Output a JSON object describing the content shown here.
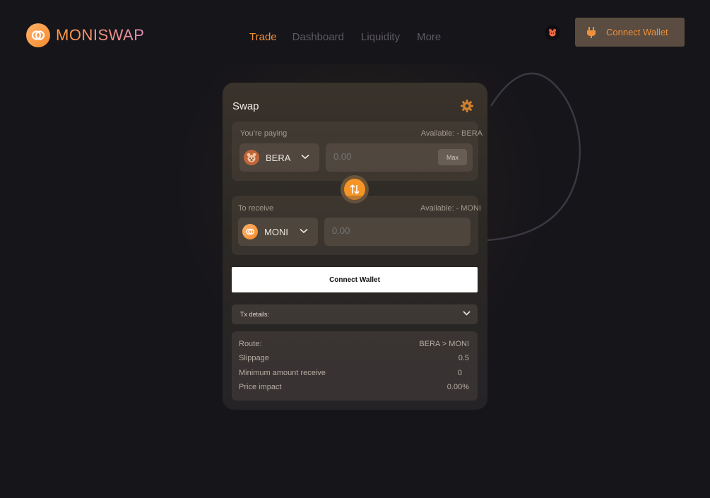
{
  "brand": {
    "name": "MONISWAP",
    "accent": "#f0913a"
  },
  "nav": {
    "items": [
      "Trade",
      "Dashboard",
      "Liquidity",
      "More"
    ],
    "active": "Trade"
  },
  "header": {
    "connect_label": "Connect Wallet",
    "network_icon": "berachain-bear-icon"
  },
  "swap": {
    "title": "Swap",
    "settings_icon": "gear-icon",
    "pay": {
      "label": "You’re paying",
      "available": "Available: - BERA",
      "token": "BERA",
      "amount_placeholder": "0.00",
      "max_label": "Max"
    },
    "receive": {
      "label": "To receive",
      "available": "Available: - MONI",
      "token": "MONI",
      "amount_placeholder": "0.00"
    },
    "connect_label": "Connect Wallet",
    "tx_details_label": "Tx details:",
    "details": [
      {
        "key": "Route:",
        "value": "BERA > MONI"
      },
      {
        "key": "Slippage",
        "value": "0.5"
      },
      {
        "key": "Minimum amount receive",
        "value": "0"
      },
      {
        "key": "Price impact",
        "value": "0.00%"
      }
    ]
  }
}
